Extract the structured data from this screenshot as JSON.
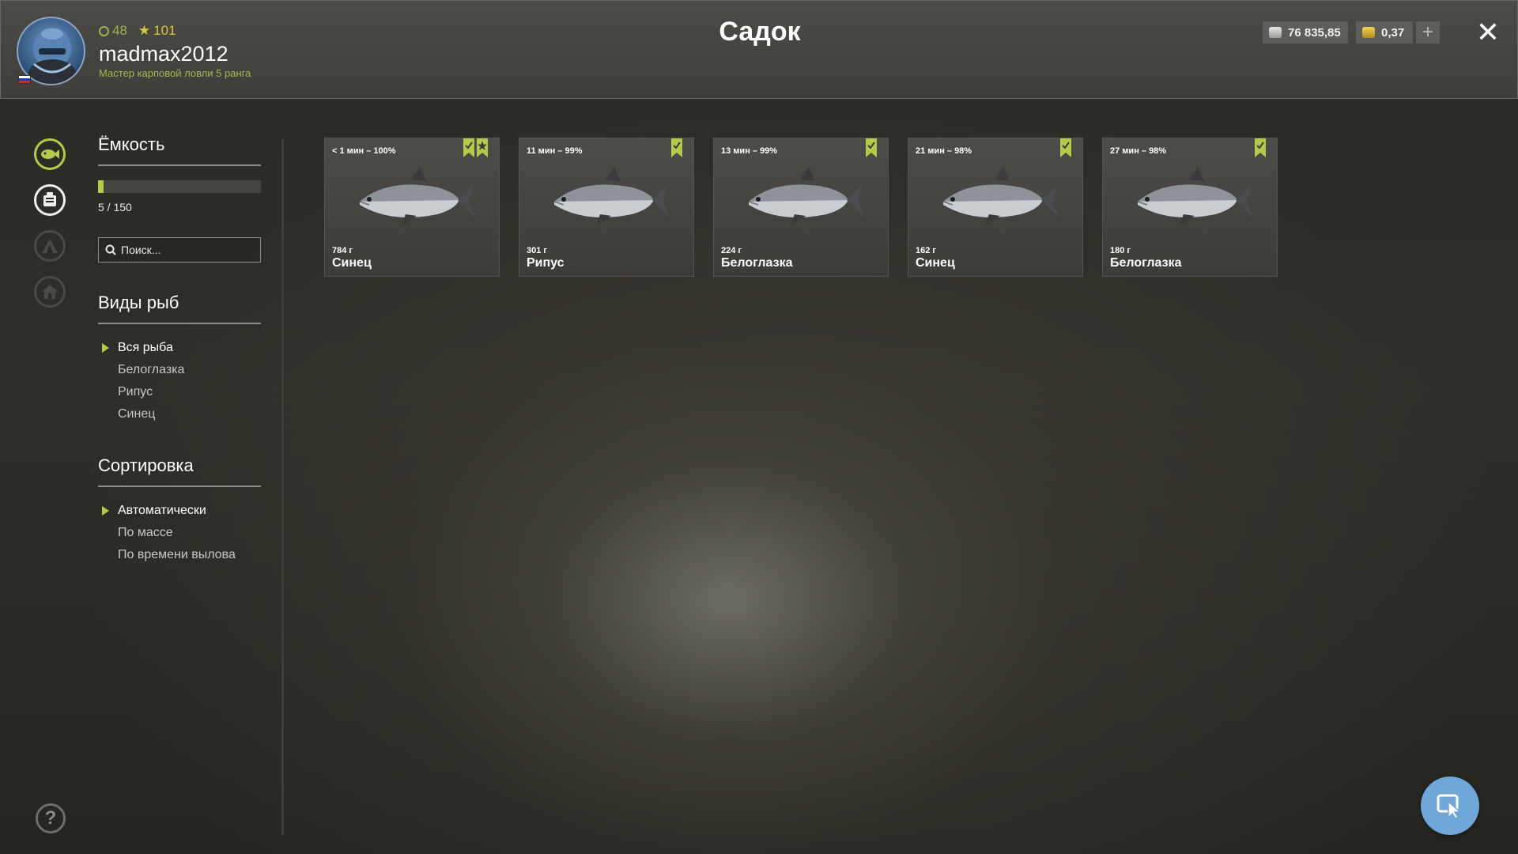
{
  "header": {
    "title": "Садок",
    "player": {
      "username": "madmax2012",
      "level": "48",
      "stars": "101",
      "rank": "Мастер карповой ловли 5 ранга"
    },
    "currency": {
      "silver": "76 835,85",
      "gold": "0,37"
    },
    "add_label": "+",
    "close_label": "✕"
  },
  "sidebar": {
    "capacity": {
      "title": "Ёмкость",
      "current": 5,
      "max": 150,
      "text": "5 / 150"
    },
    "search": {
      "placeholder": "Поиск..."
    },
    "species": {
      "title": "Виды рыб",
      "items": [
        "Вся рыба",
        "Белоглазка",
        "Рипус",
        "Синец"
      ],
      "selected": "Вся рыба"
    },
    "sort": {
      "title": "Сортировка",
      "items": [
        "Автоматически",
        "По массе",
        "По времени вылова"
      ],
      "selected": "Автоматически"
    },
    "help_label": "?"
  },
  "fish": [
    {
      "time": "< 1 мин – 100%",
      "weight": "784 г",
      "name": "Синец",
      "badges": [
        "bookmark",
        "star-bookmark"
      ]
    },
    {
      "time": "11 мин – 99%",
      "weight": "301 г",
      "name": "Рипус",
      "badges": [
        "bookmark"
      ]
    },
    {
      "time": "13 мин – 99%",
      "weight": "224 г",
      "name": "Белоглазка",
      "badges": [
        "bookmark"
      ]
    },
    {
      "time": "21 мин – 98%",
      "weight": "162 г",
      "name": "Синец",
      "badges": [
        "bookmark"
      ]
    },
    {
      "time": "27 мин – 98%",
      "weight": "180 г",
      "name": "Белоглазка",
      "badges": [
        "bookmark"
      ]
    }
  ],
  "colors": {
    "accent": "#b7c94a",
    "cursor_button": "#6fa7d9"
  }
}
